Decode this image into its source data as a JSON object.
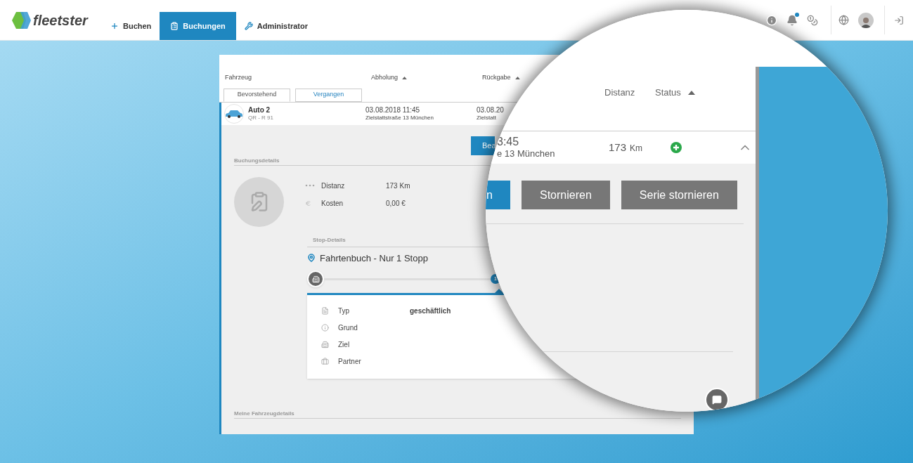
{
  "nav": {
    "logo": "fleetster",
    "items": [
      {
        "kind": "add",
        "label": "Buchen",
        "selected": false
      },
      {
        "kind": "bookings",
        "label": "Buchungen",
        "selected": true
      },
      {
        "kind": "admin",
        "label": "Administrator",
        "selected": false
      }
    ],
    "tools": [
      {
        "kind": "info",
        "badge": false
      },
      {
        "kind": "bell",
        "badge": true
      },
      {
        "kind": "coins",
        "badge": false
      }
    ]
  },
  "table": {
    "columns": [
      {
        "label": "Fahrzeug",
        "sorted": false
      },
      {
        "label": "Abholung",
        "sorted": true
      },
      {
        "label": "Rückgabe",
        "sorted": true
      }
    ],
    "tabs": [
      {
        "label": "Bevorstehend",
        "selected": true
      },
      {
        "label": "Vergangen",
        "selected": false
      }
    ],
    "booking": {
      "vehicle": "Auto 2",
      "plate": "QR - R 91",
      "pickup_time": "03.08.2018 11:45",
      "pickup_place": "Zielstattstraße 13 München",
      "return_time": "03.08.20",
      "return_place": "Zielstatt"
    }
  },
  "details": {
    "edit_button": "Bea",
    "section": "Buchungsdetails",
    "facts": [
      {
        "kind": "distance",
        "label": "Distanz",
        "value": "173 Km"
      },
      {
        "kind": "cost",
        "label": "Kosten",
        "value": "0,00 €"
      }
    ],
    "stops_section": "Stop-Details",
    "trip_title": "Fahrtenbuch - Nur 1 Stopp",
    "stop_number": "1",
    "stop_fields": [
      {
        "kind": "type",
        "label": "Typ",
        "value": "geschäftlich"
      },
      {
        "kind": "reason",
        "label": "Grund"
      },
      {
        "kind": "destination",
        "label": "Ziel"
      },
      {
        "kind": "partner",
        "label": "Partner"
      }
    ],
    "vehicle_section": "Meine Fahrzeugdetails"
  },
  "magnifier": {
    "columns": [
      {
        "label": "Distanz",
        "sorted": false
      },
      {
        "label": "Status",
        "sorted": true
      }
    ],
    "row": {
      "time": "3:45",
      "place": "e 13 München",
      "distance": "173",
      "unit": "Km"
    },
    "buttons": [
      {
        "kind": "primary",
        "label": "n"
      },
      {
        "kind": "secondary",
        "label": "Stornieren"
      },
      {
        "kind": "secondary",
        "label": "Serie stornieren"
      }
    ]
  }
}
